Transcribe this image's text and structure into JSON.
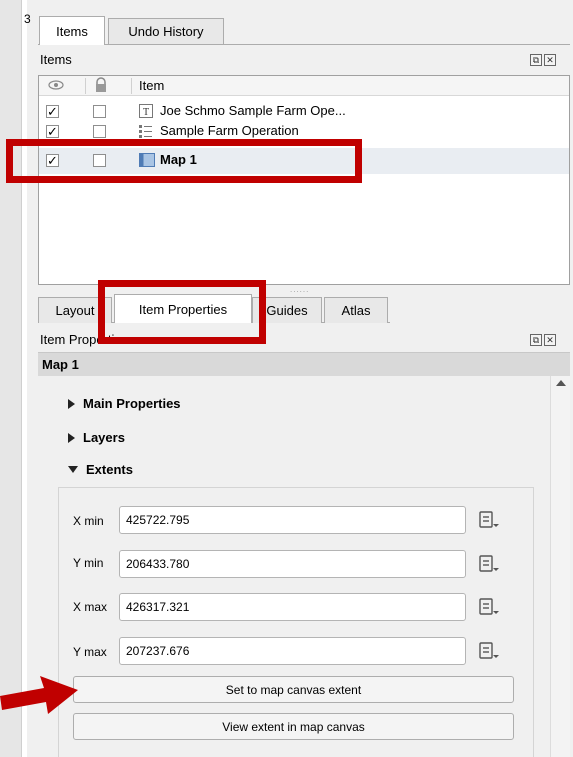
{
  "gutter_number": "3",
  "top_tabs": [
    {
      "label": "Items",
      "active": true
    },
    {
      "label": "Undo History",
      "active": false
    }
  ],
  "items_panel": {
    "title": "Items",
    "header": {
      "item_col": "Item",
      "visible_icon": "eye-icon",
      "lock_icon": "lock-icon"
    },
    "rows": [
      {
        "visible": "✓",
        "locked": "",
        "icon": "text-label-icon",
        "label": "Joe Schmo Sample Farm Ope..."
      },
      {
        "visible": "✓",
        "locked": "",
        "icon": "legend-icon",
        "label": "Sample Farm Operation"
      },
      {
        "visible": "✓",
        "locked": "",
        "icon": "map-icon",
        "label": "Map 1"
      }
    ]
  },
  "bottom_tabs": [
    {
      "label": "Layout",
      "active": false
    },
    {
      "label": "Item Properties",
      "active": true
    },
    {
      "label": "Guides",
      "active": false
    },
    {
      "label": "Atlas",
      "active": false
    }
  ],
  "item_properties": {
    "title": "Item Properties",
    "item_name": "Map 1",
    "sections": {
      "main": "Main Properties",
      "layers": "Layers",
      "extents": "Extents"
    },
    "extents": {
      "xmin_label": "X min",
      "xmin": "425722.795",
      "ymin_label": "Y min",
      "ymin": "206433.780",
      "xmax_label": "X max",
      "xmax": "426317.321",
      "ymax_label": "Y max",
      "ymax": "207237.676"
    },
    "buttons": {
      "set_extent": "Set to map canvas extent",
      "view_extent": "View extent in map canvas"
    }
  },
  "colors": {
    "highlight": "#c00000",
    "selected_row": "#e9edf2"
  }
}
